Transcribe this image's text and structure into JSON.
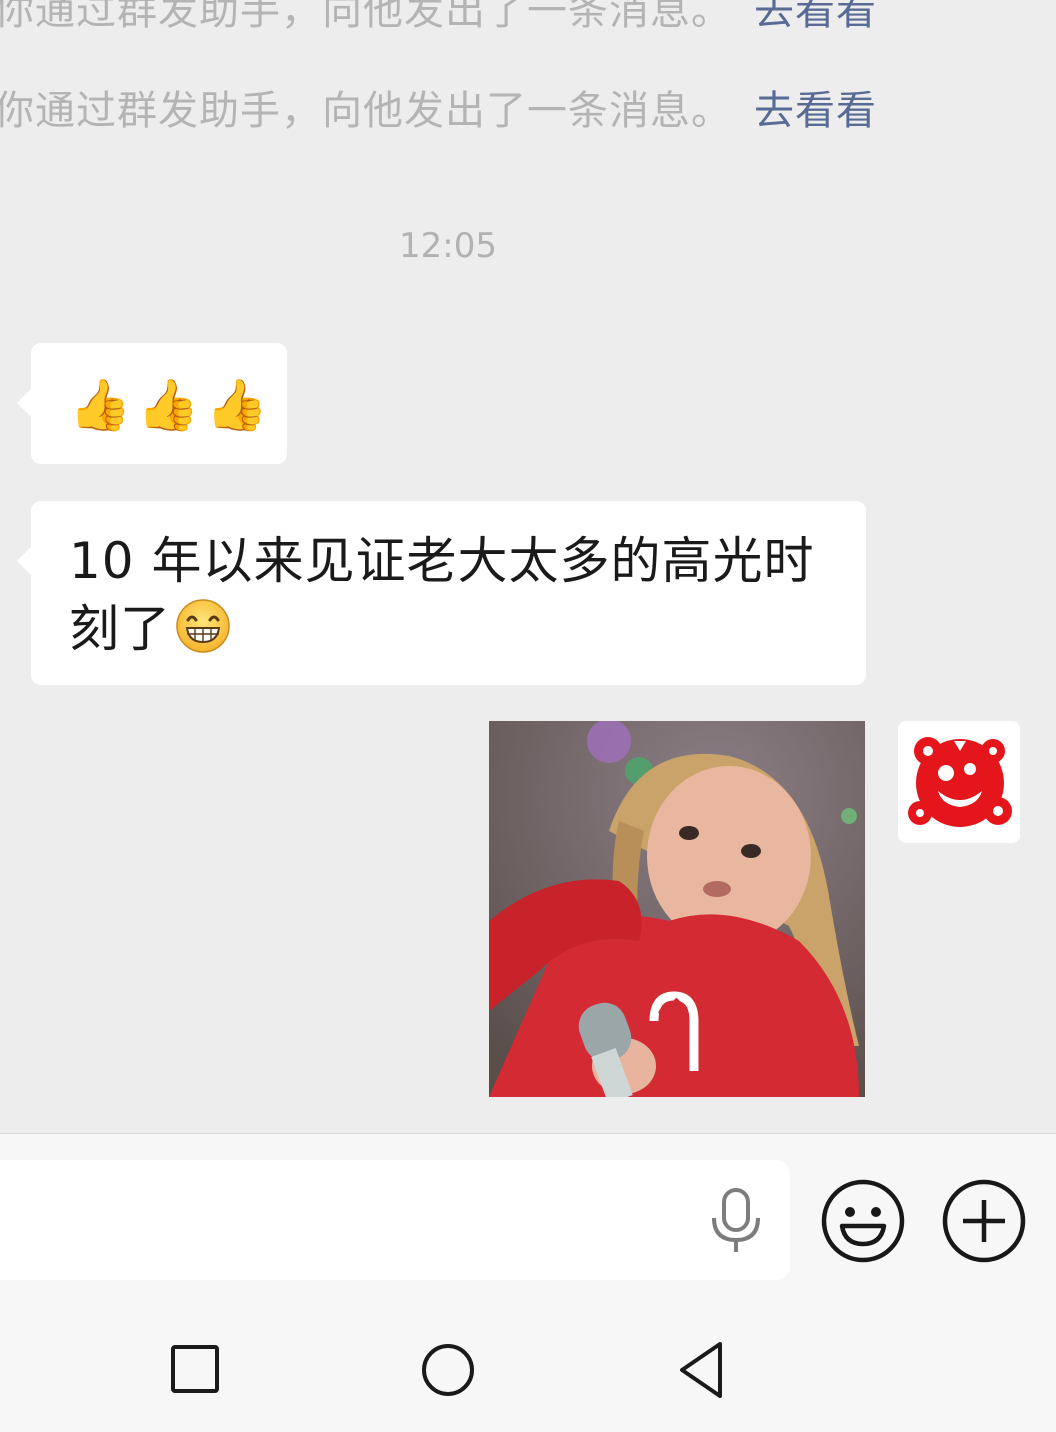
{
  "system_notices": [
    {
      "text": "你通过群发助手，向他发出了一条消息。",
      "link": "去看看"
    },
    {
      "text": "你通过群发助手，向他发出了一条消息。",
      "link": "去看看"
    }
  ],
  "timestamp": "12:05",
  "messages": [
    {
      "sender": "other",
      "type": "emoji",
      "content": "👍👍👍",
      "icon": "thumbs-up-icon"
    },
    {
      "sender": "other",
      "type": "text",
      "content": "10 年以来见证老大太多的高光时刻了",
      "icon": "grinning-face-icon"
    },
    {
      "sender": "self",
      "type": "image",
      "content": "animated sticker: girl in red sweater holding microphone"
    }
  ],
  "input_bar": {
    "value": "",
    "icons": [
      "microphone-icon",
      "emoji-icon",
      "plus-icon"
    ]
  },
  "nav_bar": {
    "icons": [
      "recents-square-icon",
      "home-circle-icon",
      "back-triangle-icon"
    ]
  },
  "colors": {
    "background": "#ededed",
    "bubble": "#ffffff",
    "link": "#576b95",
    "notice_text": "#b4b4b4",
    "sticker_red": "#d42a33"
  }
}
